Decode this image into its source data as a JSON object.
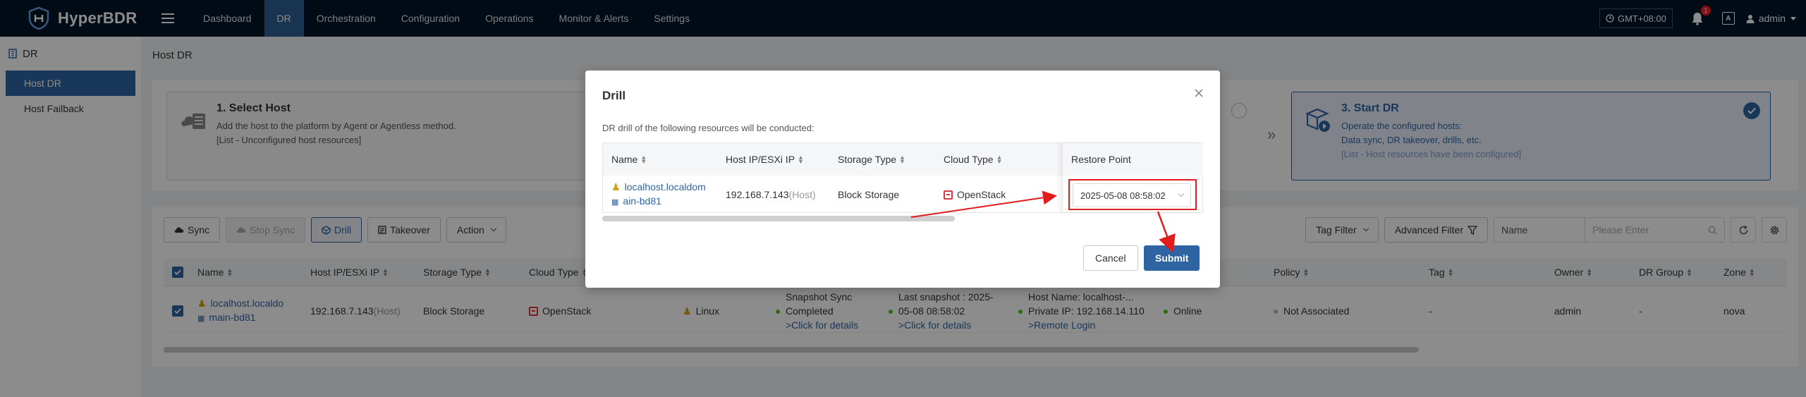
{
  "app": {
    "name": "HyperBDR"
  },
  "nav": {
    "items": [
      "Dashboard",
      "DR",
      "Orchestration",
      "Configuration",
      "Operations",
      "Monitor & Alerts",
      "Settings"
    ],
    "active": "DR",
    "timezone": "GMT+08:00",
    "alert_count": "1",
    "lang_icon_text": "A",
    "user": "admin"
  },
  "sidebar": {
    "group": "DR",
    "items": [
      {
        "label": "Host DR",
        "active": true
      },
      {
        "label": "Host Failback",
        "active": false
      }
    ]
  },
  "page": {
    "title": "Host DR"
  },
  "steps": {
    "step1": {
      "title": "1. Select Host",
      "lines": [
        "Add the host to the platform by Agent or Agentless method.",
        "[List - Unconfigured host resources]"
      ]
    },
    "step3": {
      "title": "3. Start DR",
      "lines": [
        "Operate the configured hosts:",
        "Data sync, DR takeover, drills, etc.",
        "[List - Host resources have been configured]"
      ]
    }
  },
  "toolbar": {
    "sync": "Sync",
    "stop_sync": "Stop Sync",
    "drill": "Drill",
    "takeover": "Takeover",
    "action": "Action",
    "tag_filter": "Tag Filter",
    "advanced_filter": "Advanced Filter",
    "search_field": "Name",
    "search_placeholder": "Please Enter"
  },
  "table": {
    "headers": {
      "name": "Name",
      "ip": "Host IP/ESXi IP",
      "storage": "Storage Type",
      "cloud": "Cloud Type",
      "policy": "Policy",
      "tag": "Tag",
      "owner": "Owner",
      "dr_group": "DR Group",
      "zone": "Zone"
    },
    "row": {
      "name_line1": "localhost.localdo",
      "name_line2": "main-bd81",
      "ip": "192.168.7.143",
      "ip_suffix": "(Host)",
      "storage": "Block Storage",
      "cloud": "OpenStack",
      "os": "Linux",
      "sync_line1": "Snapshot Sync",
      "sync_line2": "Completed",
      "sync_link": ">Click for details",
      "snap_line1": "Last snapshot : 2025-",
      "snap_line2": "05-08 08:58:02",
      "snap_link": ">Click for details",
      "host_line1": "Host Name: localhost-...",
      "host_line2": "Private IP: 192.168.14.110",
      "host_link": ">Remote Login",
      "status": "Online",
      "policy": "Not Associated",
      "tag": "-",
      "owner": "admin",
      "dr_group": "-",
      "zone": "nova"
    }
  },
  "modal": {
    "title": "Drill",
    "description": "DR drill of the following resources will be conducted:",
    "headers": {
      "name": "Name",
      "ip": "Host IP/ESXi IP",
      "storage": "Storage Type",
      "cloud": "Cloud Type",
      "restore": "Restore Point"
    },
    "row": {
      "name_line1": "localhost.localdom",
      "name_line2": "ain-bd81",
      "ip": "192.168.7.143",
      "ip_suffix": "(Host)",
      "storage": "Block Storage",
      "cloud": "OpenStack",
      "restore_point": "2025-05-08 08:58:02"
    },
    "cancel": "Cancel",
    "submit": "Submit"
  },
  "colors": {
    "nav_bg": "#001529",
    "primary": "#2f64a3",
    "annotation": "#e01c1c",
    "online": "#52c41a"
  }
}
